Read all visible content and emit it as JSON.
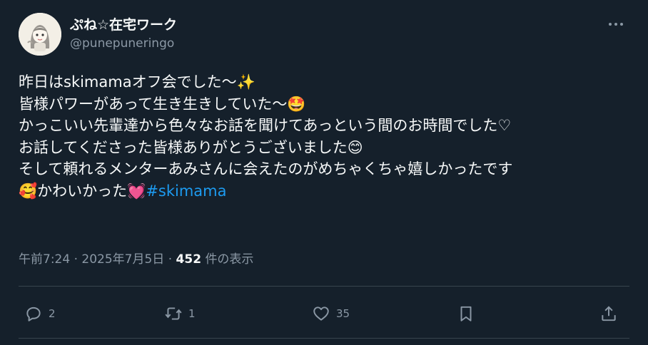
{
  "user": {
    "display_name": "ぷね☆在宅ワーク",
    "handle": "@punepuneringo"
  },
  "post": {
    "lines": [
      {
        "text": "昨日はskimamaオフ会でした〜",
        "emoji": "✨"
      },
      {
        "text": "皆様パワーがあって生き生きしていた〜",
        "emoji": "🤩"
      },
      {
        "text": "かっこいい先輩達から色々なお話を聞けてあっという間のお時間でした♡",
        "emoji": ""
      },
      {
        "text": "お話してくださった皆様ありがとうございました",
        "emoji": "😊"
      },
      {
        "text": "そして頼れるメンターあみさんに会えたのがめちゃくちゃ嬉しかったです",
        "emoji": ""
      }
    ],
    "last_line": {
      "emoji_start": "🥰",
      "text": "かわいかった",
      "emoji_end": "💓",
      "hashtag": "#skimama"
    }
  },
  "meta": {
    "time": "午前7:24",
    "separator": "·",
    "date": "2025年7月5日",
    "views_count": "452",
    "views_label": "件の表示"
  },
  "actions": {
    "reply_count": "2",
    "repost_count": "1",
    "like_count": "35"
  },
  "icons": {
    "more": "more-icon",
    "reply": "reply-icon",
    "repost": "repost-icon",
    "like": "like-icon",
    "bookmark": "bookmark-icon",
    "share": "share-icon"
  },
  "colors": {
    "background": "#15202b",
    "text": "#f7f9f9",
    "secondary": "#8b98a5",
    "accent": "#1d9bf0"
  }
}
